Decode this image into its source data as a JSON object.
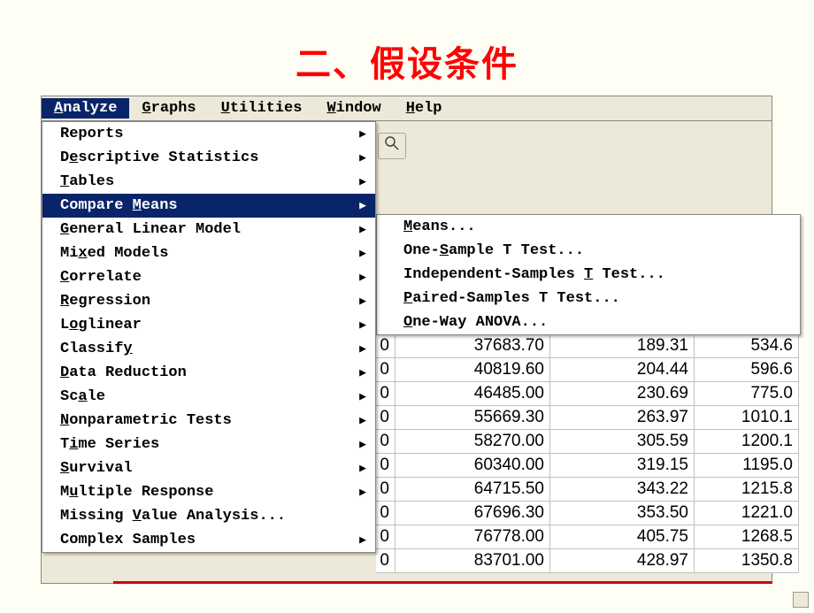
{
  "title": "二、假设条件",
  "menubar": {
    "analyze": "Analyze",
    "graphs": "Graphs",
    "utilities": "Utilities",
    "window": "Window",
    "help": "Help"
  },
  "analyze_menu": {
    "reports": "Reports",
    "descriptive": "Descriptive Statistics",
    "tables": "Tables",
    "compare_means": "Compare Means",
    "glm": "General Linear Model",
    "mixed": "Mixed Models",
    "correlate": "Correlate",
    "regression": "Regression",
    "loglinear": "Loglinear",
    "classify": "Classify",
    "data_reduction": "Data Reduction",
    "scale": "Scale",
    "nonparametric": "Nonparametric Tests",
    "time_series": "Time Series",
    "survival": "Survival",
    "multiple_response": "Multiple Response",
    "missing_value": "Missing Value Analysis...",
    "complex_samples": "Complex Samples"
  },
  "compare_submenu": {
    "means": "Means...",
    "one_sample": "One-Sample T Test...",
    "independent": "Independent-Samples T Test...",
    "paired": "Paired-Samples T Test...",
    "oneway": "One-Way ANOVA..."
  },
  "grid": {
    "rows": [
      {
        "c0": "0",
        "c1": "37683.70",
        "c2": "189.31",
        "c3": "534.6"
      },
      {
        "c0": "0",
        "c1": "40819.60",
        "c2": "204.44",
        "c3": "596.6"
      },
      {
        "c0": "0",
        "c1": "46485.00",
        "c2": "230.69",
        "c3": "775.0"
      },
      {
        "c0": "0",
        "c1": "55669.30",
        "c2": "263.97",
        "c3": "1010.1"
      },
      {
        "c0": "0",
        "c1": "58270.00",
        "c2": "305.59",
        "c3": "1200.1"
      },
      {
        "c0": "0",
        "c1": "60340.00",
        "c2": "319.15",
        "c3": "1195.0"
      },
      {
        "c0": "0",
        "c1": "64715.50",
        "c2": "343.22",
        "c3": "1215.8"
      },
      {
        "c0": "0",
        "c1": "67696.30",
        "c2": "353.50",
        "c3": "1221.0"
      },
      {
        "c0": "0",
        "c1": "76778.00",
        "c2": "405.75",
        "c3": "1268.5"
      },
      {
        "c0": "0",
        "c1": "83701.00",
        "c2": "428.97",
        "c3": "1350.8"
      }
    ]
  }
}
